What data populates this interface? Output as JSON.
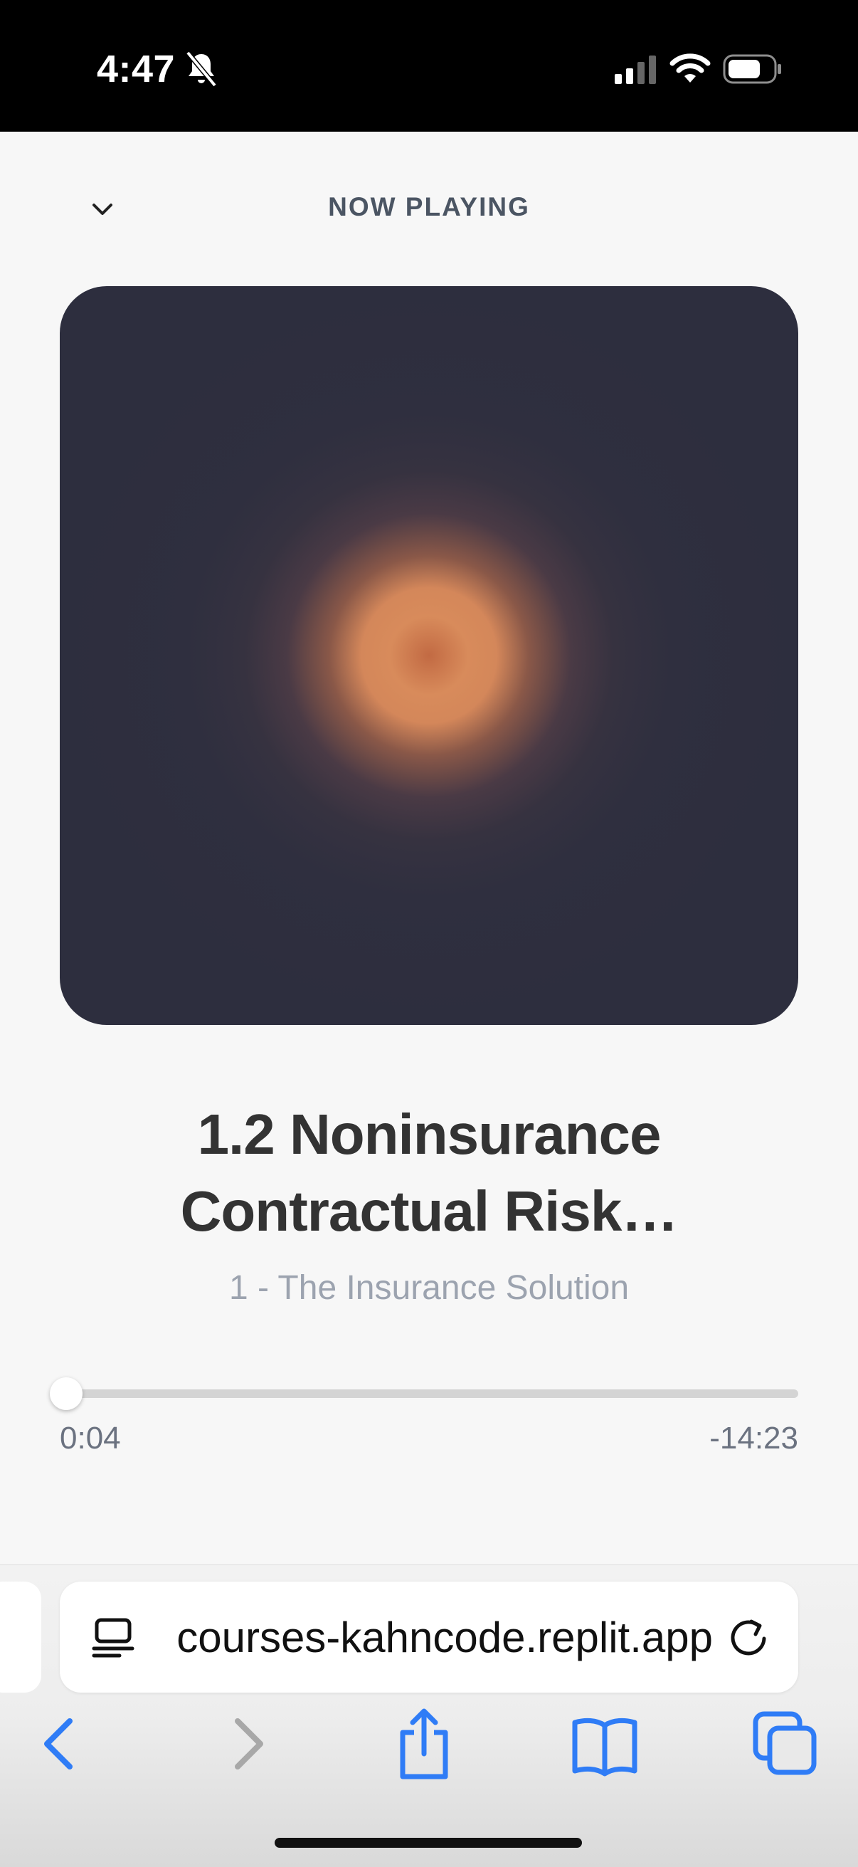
{
  "status_bar": {
    "time": "4:47"
  },
  "header": {
    "label": "NOW PLAYING"
  },
  "track": {
    "title": "1.2 Noninsurance Contractual Risk…",
    "subtitle": "1 - The Insurance Solution"
  },
  "progress": {
    "elapsed": "0:04",
    "remaining": "-14:23",
    "fraction": 0.005
  },
  "browser": {
    "url": "courses-kahncode.replit.app"
  },
  "colors": {
    "artwork_bg": "#2d2e3e",
    "artwork_glow": "#d4875a",
    "accent_blue": "#2f7cf6"
  }
}
